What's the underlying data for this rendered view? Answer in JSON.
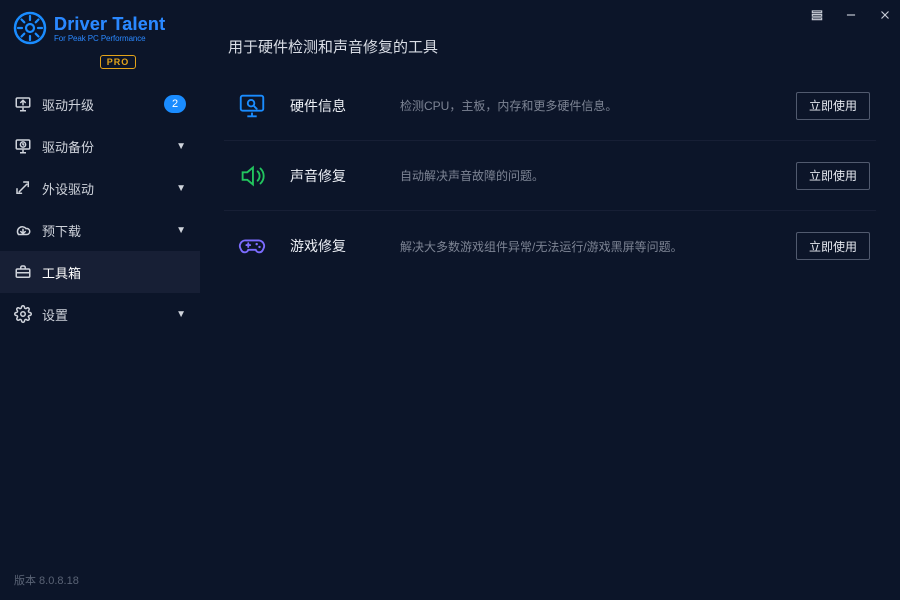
{
  "app": {
    "title": "Driver Talent",
    "subtitle": "For Peak PC Performance",
    "pro_badge": "PRO",
    "version": "版本 8.0.8.18"
  },
  "sidebar": {
    "items": [
      {
        "id": "driver-upgrade",
        "label": "驱动升级",
        "has_badge": true,
        "badge_text": "2",
        "has_caret": false
      },
      {
        "id": "driver-backup",
        "label": "驱动备份",
        "has_badge": false,
        "has_caret": true
      },
      {
        "id": "peripheral",
        "label": "外设驱动",
        "has_badge": false,
        "has_caret": true
      },
      {
        "id": "predownload",
        "label": "预下载",
        "has_badge": false,
        "has_caret": true
      },
      {
        "id": "toolbox",
        "label": "工具箱",
        "has_badge": false,
        "has_caret": false
      },
      {
        "id": "settings",
        "label": "设置",
        "has_badge": false,
        "has_caret": true
      }
    ],
    "active_index": 4
  },
  "page": {
    "title": "用于硬件检测和声音修复的工具",
    "action_label": "立即使用",
    "tools": [
      {
        "id": "hardware-info",
        "name": "硬件信息",
        "desc": "检测CPU，主板，内存和更多硬件信息。",
        "icon": "monitor-search",
        "icon_color": "#1a8cff"
      },
      {
        "id": "audio-fix",
        "name": "声音修复",
        "desc": "自动解决声音故障的问题。",
        "icon": "speaker",
        "icon_color": "#22c55e"
      },
      {
        "id": "game-fix",
        "name": "游戏修复",
        "desc": "解决大多数游戏组件异常/无法运行/游戏黑屏等问题。",
        "icon": "gamepad",
        "icon_color": "#7c6cff"
      }
    ]
  }
}
